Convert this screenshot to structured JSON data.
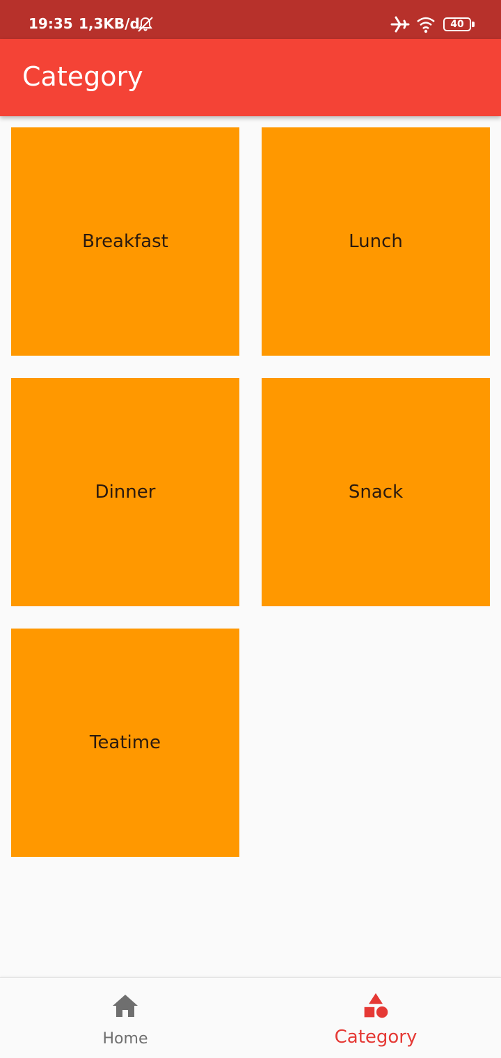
{
  "status_bar": {
    "time": "19:35",
    "network_speed": "1,3KB/d",
    "battery": "40"
  },
  "app_bar": {
    "title": "Category"
  },
  "categories": [
    {
      "label": "Breakfast"
    },
    {
      "label": "Lunch"
    },
    {
      "label": "Dinner"
    },
    {
      "label": "Snack"
    },
    {
      "label": "Teatime"
    }
  ],
  "bottom_nav": {
    "items": [
      {
        "label": "Home",
        "icon": "home-icon",
        "active": false
      },
      {
        "label": "Category",
        "icon": "shapes-icon",
        "active": true
      }
    ]
  },
  "colors": {
    "status_bar": "#b7312b",
    "app_bar": "#f44336",
    "tile": "#ff9800",
    "active_nav": "#e53935",
    "inactive_nav": "#6f6f6f"
  }
}
